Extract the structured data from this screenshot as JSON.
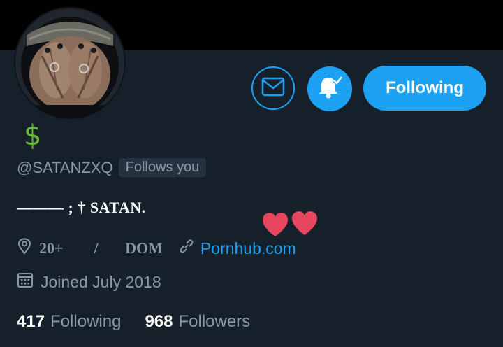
{
  "profile": {
    "display_emoji": "$",
    "handle": "@SATANZXQ",
    "follows_you": "Follows you",
    "bio": "——— ; † SATAN.",
    "location": "20+        /       DOM",
    "url": "Pornhub.com",
    "joined": "Joined July 2018"
  },
  "actions": {
    "follow_label": "Following"
  },
  "stats": {
    "following_count": "417",
    "following_label": "Following",
    "followers_count": "968",
    "followers_label": "Followers"
  },
  "colors": {
    "background": "#15202b",
    "banner": "#000000",
    "accent": "#1da1f2",
    "secondary_text": "#8899a6",
    "emoji_green": "#66bb33",
    "hearts": "#e8455f"
  },
  "icons": [
    "envelope-icon",
    "bell-icon",
    "location-pin-icon",
    "link-icon",
    "calendar-icon",
    "heart-icon"
  ]
}
